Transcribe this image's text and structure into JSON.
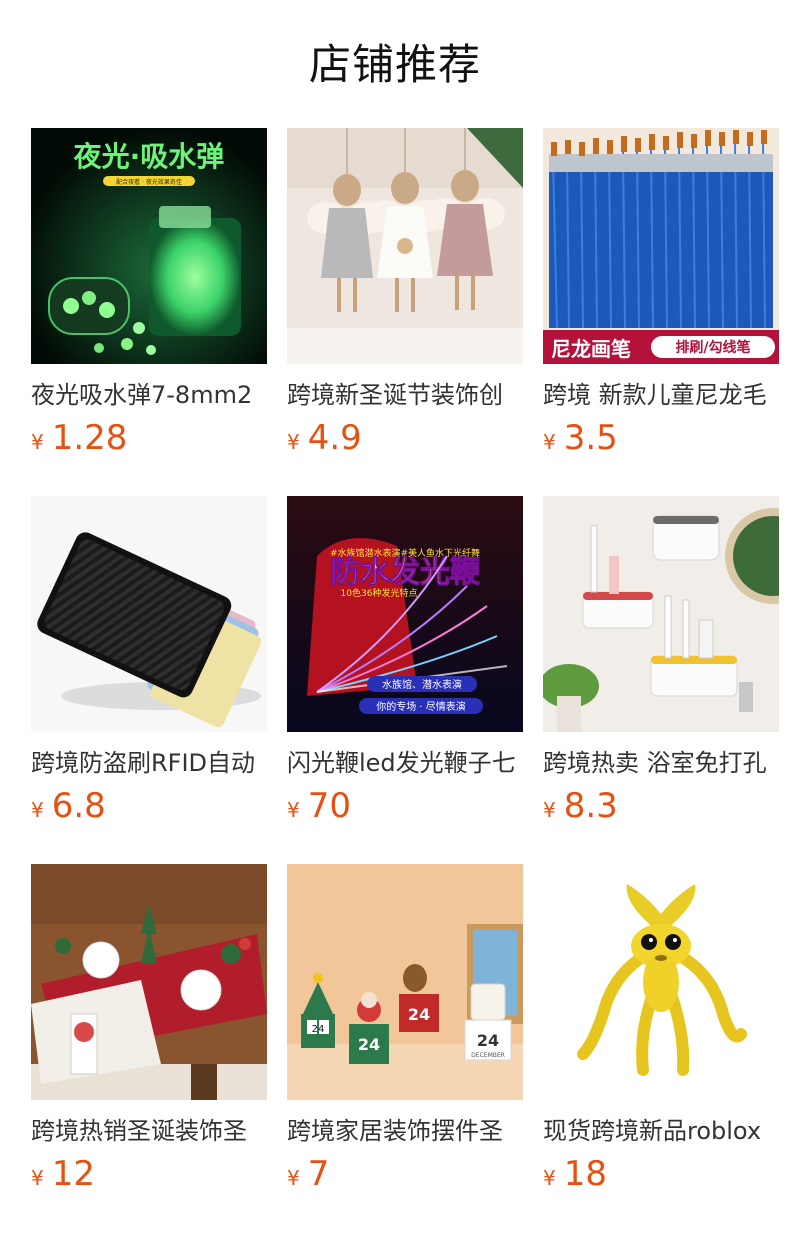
{
  "section": {
    "title": "店铺推荐"
  },
  "theme": {
    "price_color": "#e65012",
    "text_color": "#333333"
  },
  "products": [
    {
      "name": "夜光吸水弹7-8mm2",
      "currency": "¥",
      "price": "1.28",
      "image": "glow-water-beads-image",
      "image_text": [
        "夜光·吸水弹",
        "配合夜看 · 夜光效果奇佳"
      ]
    },
    {
      "name": "跨境新圣诞节装饰创",
      "currency": "¥",
      "price": "4.9",
      "image": "angel-doll-ornaments-image"
    },
    {
      "name": "跨境 新款儿童尼龙毛",
      "currency": "¥",
      "price": "3.5",
      "image": "nylon-paint-brushes-image",
      "image_text": [
        "尼龙画笔",
        "排刷/勾线笔"
      ]
    },
    {
      "name": "跨境防盗刷RFID自动",
      "currency": "¥",
      "price": "6.8",
      "image": "rfid-card-wallet-image"
    },
    {
      "name": "闪光鞭led发光鞭子七",
      "currency": "¥",
      "price": "70",
      "image": "led-fiber-whip-image",
      "image_text": [
        "#水族馆潜水表演#美人鱼水下光纤舞",
        "防水发光鞭",
        "10色36种发光特点",
        "水族馆、潜水表演",
        "你的专场 · 尽情表演"
      ]
    },
    {
      "name": "跨境热卖 浴室免打孔",
      "currency": "¥",
      "price": "8.3",
      "image": "toothbrush-holder-image"
    },
    {
      "name": "跨境热销圣诞装饰圣",
      "currency": "¥",
      "price": "12",
      "image": "christmas-table-runner-image"
    },
    {
      "name": "跨境家居装饰摆件圣",
      "currency": "¥",
      "price": "7",
      "image": "christmas-calendar-ornament-image",
      "image_text": [
        "24",
        "24",
        "24",
        "24",
        "DECEMBER"
      ]
    },
    {
      "name": "现货跨境新品roblox",
      "currency": "¥",
      "price": "18",
      "image": "yellow-plush-toy-image"
    }
  ]
}
